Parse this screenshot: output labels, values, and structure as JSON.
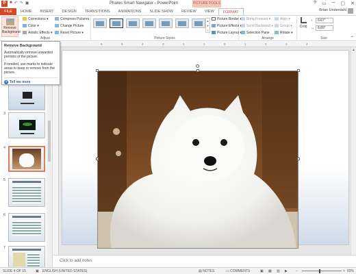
{
  "titlebar": {
    "app_icon": "P",
    "quick_access": [
      "save-icon",
      "undo-icon",
      "redo-icon",
      "start-from-beginning-icon"
    ],
    "quick_access_glyphs": [
      "■",
      "↶",
      "↷",
      "▣"
    ],
    "title": "Phares Smart Navigator - PowerPoint",
    "context_label": "PICTURE TOOLS",
    "window_buttons": [
      "?",
      "▭",
      "─",
      "▢",
      "✕"
    ]
  },
  "tabs": [
    "FILE",
    "HOME",
    "INSERT",
    "DESIGN",
    "TRANSITIONS",
    "ANIMATIONS",
    "SLIDE SHOW",
    "REVIEW",
    "VIEW",
    "FORMAT"
  ],
  "active_tab": "FORMAT",
  "user_name": "Brian Underdahl",
  "ribbon": {
    "adjust": {
      "remove_background": [
        "Remove",
        "Background"
      ],
      "corrections": "Corrections ▾",
      "color": "Color ▾",
      "artistic_effects": "Artistic Effects ▾",
      "compress_pictures": "Compress Pictures",
      "change_picture": "Change Picture",
      "reset_picture": "Reset Picture ▾",
      "label": "Adjust"
    },
    "picture_styles": {
      "picture_border": "Picture Border ▾",
      "picture_effects": "Picture Effects ▾",
      "picture_layout": "Picture Layout ▾",
      "label": "Picture Styles"
    },
    "arrange": {
      "bring_forward": "Bring Forward ▾",
      "send_backward": "Send Backward ▾",
      "selection_pane": "Selection Pane",
      "align": "Align ▾",
      "group": "Group ▾",
      "rotate": "Rotate ▾",
      "label": "Arrange"
    },
    "size": {
      "crop": "Crop",
      "height": "6.67\"",
      "width": "8.89\"",
      "label": "Size"
    }
  },
  "tooltip": {
    "title": "Remove Background",
    "body1": "Automatically remove unwanted portions of the picture.",
    "body2": "If needed, use marks to indicate areas to keep or remove from the picture.",
    "link": "Tell me more"
  },
  "slides": [
    {
      "num": "2"
    },
    {
      "num": "3"
    },
    {
      "num": "4",
      "selected": true
    },
    {
      "num": "5"
    },
    {
      "num": "6"
    },
    {
      "num": "7"
    }
  ],
  "ruler_ticks": [
    "6",
    "5",
    "4",
    "3",
    "2",
    "1",
    "0",
    "1",
    "2",
    "3",
    "4",
    "5",
    "6"
  ],
  "notes_placeholder": "Click to add notes",
  "status": {
    "slide_info": "SLIDE 4 OF 15",
    "language": "ENGLISH (UNITED STATES)",
    "notes": "NOTES",
    "comments": "COMMENTS",
    "zoom": "69%"
  }
}
